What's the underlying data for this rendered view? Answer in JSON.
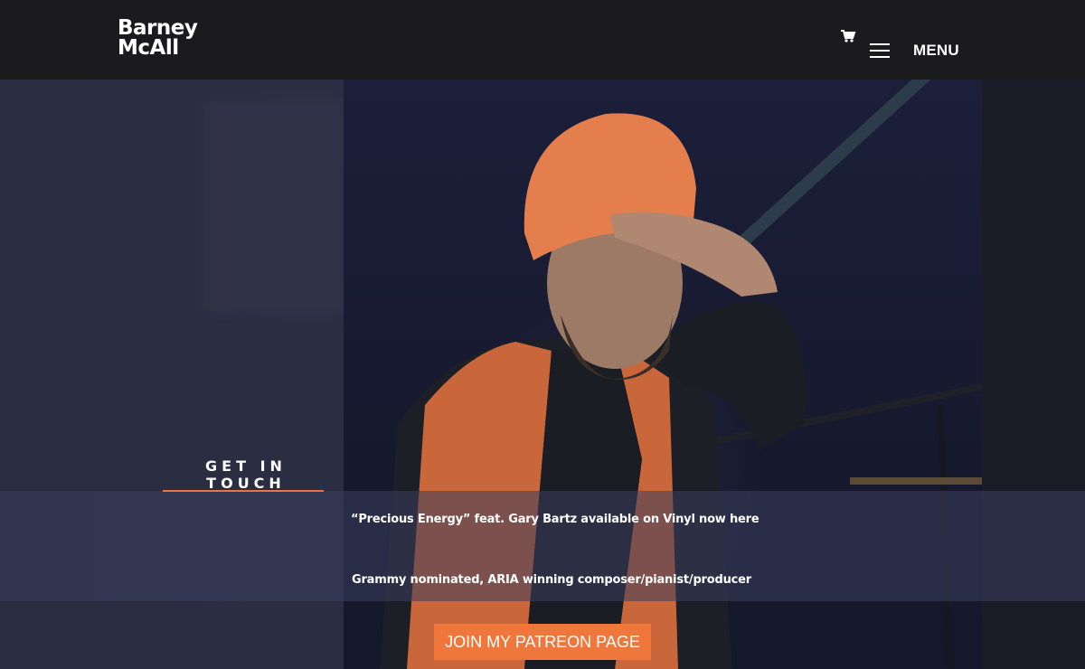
{
  "header": {
    "logo_line1": "Barney",
    "logo_line2": "McAll",
    "cart_icon": "shopping-cart-icon",
    "menu_icon": "hamburger-icon",
    "menu_label": "MENU"
  },
  "hero": {
    "get_in_touch": "GET IN TOUCH",
    "line1_prefix": "“Precious Energy” feat. Gary Bartz available on Vinyl now ",
    "line1_link": "here",
    "line2": "Grammy nominated, ARIA winning composer/pianist/producer",
    "patreon_button": "JOIN MY PATREON PAGE"
  },
  "colors": {
    "accent": "#f0773b",
    "header_bg": "#1b1b1d",
    "page_bg": "#26283a"
  }
}
